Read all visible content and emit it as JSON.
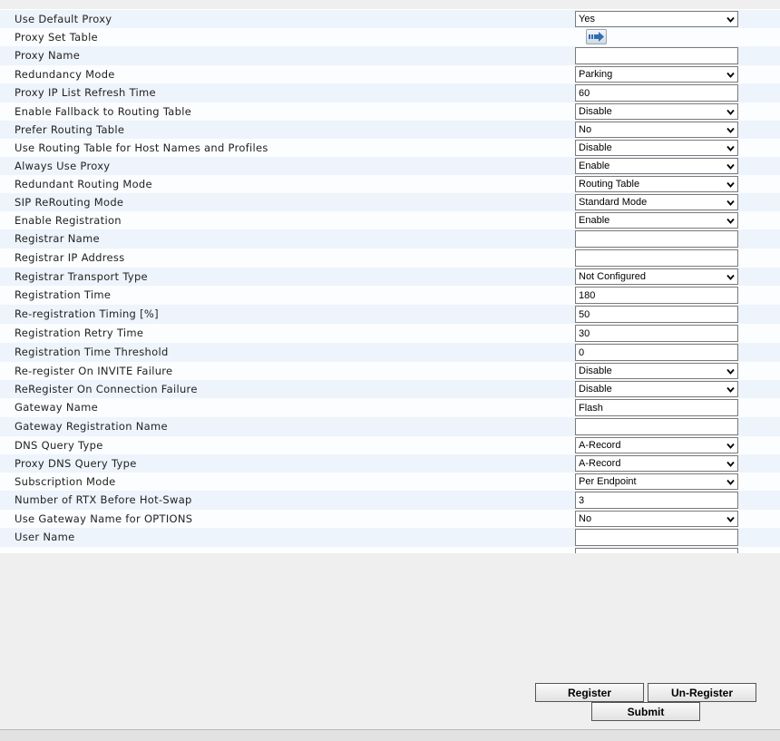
{
  "form": {
    "rows": [
      {
        "label": "Use Default Proxy",
        "type": "select",
        "value": "Yes"
      },
      {
        "label": "Proxy Set Table",
        "type": "button"
      },
      {
        "label": "Proxy Name",
        "type": "text",
        "value": ""
      },
      {
        "label": "Redundancy Mode",
        "type": "select",
        "value": "Parking"
      },
      {
        "label": "Proxy IP List Refresh Time",
        "type": "text",
        "value": "60"
      },
      {
        "label": "Enable Fallback to Routing Table",
        "type": "select",
        "value": "Disable"
      },
      {
        "label": "Prefer Routing Table",
        "type": "select",
        "value": "No"
      },
      {
        "label": "Use Routing Table for Host Names and Profiles",
        "type": "select",
        "value": "Disable"
      },
      {
        "label": "Always Use Proxy",
        "type": "select",
        "value": "Enable"
      },
      {
        "label": "Redundant Routing Mode",
        "type": "select",
        "value": "Routing Table"
      },
      {
        "label": "SIP ReRouting Mode",
        "type": "select",
        "value": "Standard Mode"
      },
      {
        "label": "Enable Registration",
        "type": "select",
        "value": "Enable"
      },
      {
        "label": "Registrar Name",
        "type": "text",
        "value": ""
      },
      {
        "label": "Registrar IP Address",
        "type": "text",
        "value": ""
      },
      {
        "label": "Registrar Transport Type",
        "type": "select",
        "value": "Not Configured"
      },
      {
        "label": "Registration Time",
        "type": "text",
        "value": "180"
      },
      {
        "label": "Re-registration Timing [%]",
        "type": "text",
        "value": "50"
      },
      {
        "label": "Registration Retry Time",
        "type": "text",
        "value": "30"
      },
      {
        "label": "Registration Time Threshold",
        "type": "text",
        "value": "0"
      },
      {
        "label": "Re-register On INVITE Failure",
        "type": "select",
        "value": "Disable"
      },
      {
        "label": "ReRegister On Connection Failure",
        "type": "select",
        "value": "Disable"
      },
      {
        "label": "Gateway Name",
        "type": "text",
        "value": "Flash"
      },
      {
        "label": "Gateway Registration Name",
        "type": "text",
        "value": ""
      },
      {
        "label": "DNS Query Type",
        "type": "select",
        "value": "A-Record"
      },
      {
        "label": "Proxy DNS Query Type",
        "type": "select",
        "value": "A-Record"
      },
      {
        "label": "Subscription Mode",
        "type": "select",
        "value": "Per Endpoint"
      },
      {
        "label": "Number of RTX Before Hot-Swap",
        "type": "text",
        "value": "3"
      },
      {
        "label": "Use Gateway Name for OPTIONS",
        "type": "select",
        "value": "No"
      },
      {
        "label": "User Name",
        "type": "text",
        "value": ""
      },
      {
        "label": "",
        "type": "text",
        "value": ""
      }
    ]
  },
  "icons": {
    "proxy_set_table": "arrow-right-icon",
    "dropdown": "chevron-down-icon"
  },
  "actions": {
    "register_label": "Register",
    "unregister_label": "Un-Register",
    "submit_label": "Submit"
  }
}
